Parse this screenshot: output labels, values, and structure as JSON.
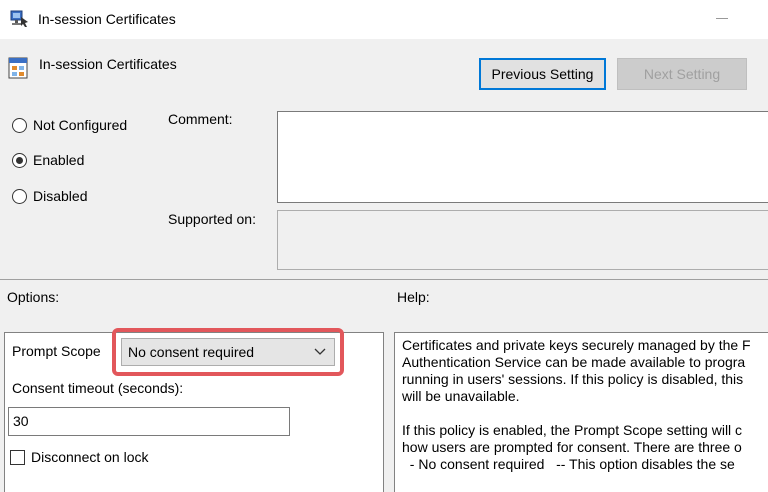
{
  "window": {
    "title": "In-session Certificates",
    "icon": "policy-app-icon"
  },
  "header": {
    "title": "In-session Certificates",
    "icon": "policy-setting-icon",
    "prev_button": "Previous Setting",
    "next_button": "Next Setting"
  },
  "state": {
    "options": [
      {
        "label": "Not Configured",
        "checked": false
      },
      {
        "label": "Enabled",
        "checked": true
      },
      {
        "label": "Disabled",
        "checked": false
      }
    ],
    "comment_label": "Comment:",
    "comment_value": "",
    "supported_label": "Supported on:",
    "supported_value": ""
  },
  "options_section": {
    "title": "Options:",
    "prompt_scope_label": "Prompt Scope",
    "prompt_scope_value": "No consent required",
    "timeout_label": "Consent timeout (seconds):",
    "timeout_value": "30",
    "disconnect_label": "Disconnect on lock",
    "disconnect_checked": false
  },
  "help_section": {
    "title": "Help:",
    "lines": [
      "Certificates and private keys securely managed by the F",
      "Authentication Service can be made available to progra",
      "running in users' sessions.  If this policy is disabled, this",
      "will be unavailable.",
      "",
      "If this policy is enabled, the Prompt Scope setting will c",
      "how users are prompted for consent.  There are three o",
      "  - No consent required   -- This option disables the se"
    ]
  },
  "colors": {
    "highlight": "#e2575b",
    "focus_border": "#0078d7",
    "dialog_bg": "#f0f0f0"
  }
}
